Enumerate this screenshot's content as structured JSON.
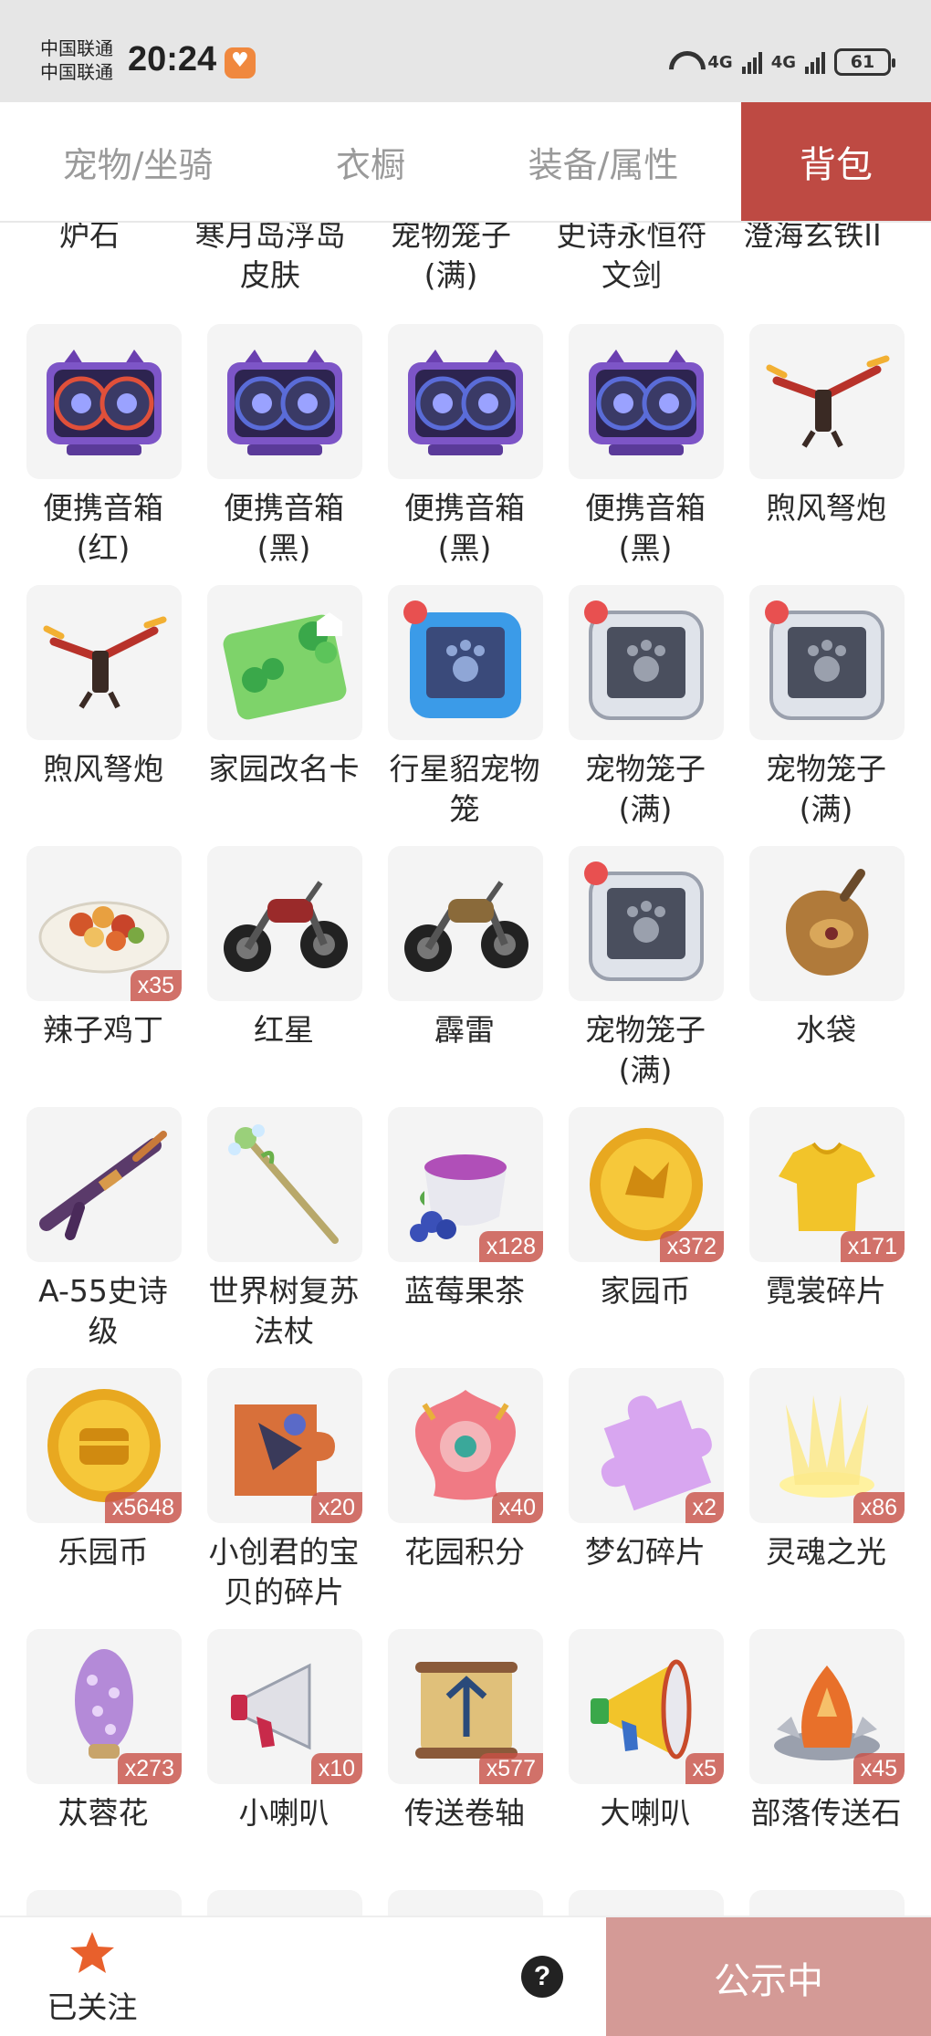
{
  "status_bar": {
    "carrier_1": "中国联通",
    "carrier_2": "中国联通",
    "time": "20:24",
    "network_1": "4G",
    "network_2": "4G",
    "battery": "61"
  },
  "tabs": [
    {
      "label": "宠物/坐骑"
    },
    {
      "label": "衣橱"
    },
    {
      "label": "装备/属性"
    },
    {
      "label": "背包",
      "active": true
    }
  ],
  "colors": {
    "accent": "#be4a43",
    "disabled_button": "#d49a96",
    "badge": "#c85046",
    "star": "#e8602c"
  },
  "top_partial_row": [
    {
      "name": "炉石"
    },
    {
      "name": "寒月岛浮岛\n皮肤"
    },
    {
      "name": "宠物笼子\n(满)"
    },
    {
      "name": "史诗永恒符\n文剑"
    },
    {
      "name": "澄海玄铁II"
    }
  ],
  "items": [
    {
      "name": "便携音箱\n(红)",
      "icon": "speaker-red-icon"
    },
    {
      "name": "便携音箱\n(黑)",
      "icon": "speaker-icon"
    },
    {
      "name": "便携音箱\n(黑)",
      "icon": "speaker-icon"
    },
    {
      "name": "便携音箱\n(黑)",
      "icon": "speaker-icon"
    },
    {
      "name": "煦风弩炮",
      "icon": "crossbow-icon"
    },
    {
      "name": "煦风弩炮",
      "icon": "crossbow-icon"
    },
    {
      "name": "家园改名卡",
      "icon": "rename-card-icon"
    },
    {
      "name": "行星貂宠物\n笼",
      "icon": "pet-cage-blue-icon"
    },
    {
      "name": "宠物笼子\n(满)",
      "icon": "pet-cage-icon"
    },
    {
      "name": "宠物笼子\n(满)",
      "icon": "pet-cage-icon"
    },
    {
      "name": "辣子鸡丁",
      "icon": "food-plate-icon",
      "qty": "x35"
    },
    {
      "name": "红星",
      "icon": "motorcycle-red-icon"
    },
    {
      "name": "霹雷",
      "icon": "motorcycle-icon"
    },
    {
      "name": "宠物笼子\n(满)",
      "icon": "pet-cage-icon"
    },
    {
      "name": "水袋",
      "icon": "water-bag-icon"
    },
    {
      "name": "A-55史诗\n级",
      "icon": "rifle-icon"
    },
    {
      "name": "世界树复苏\n法杖",
      "icon": "staff-icon"
    },
    {
      "name": "蓝莓果茶",
      "icon": "tea-cup-icon",
      "qty": "x128"
    },
    {
      "name": "家园币",
      "icon": "gold-coin-icon",
      "qty": "x372"
    },
    {
      "name": "霓裳碎片",
      "icon": "shirt-icon",
      "qty": "x171"
    },
    {
      "name": "乐园币",
      "icon": "chest-coin-icon",
      "qty": "x5648"
    },
    {
      "name": "小创君的宝\n贝的碎片",
      "icon": "puzzle-picture-icon",
      "qty": "x20"
    },
    {
      "name": "花园积分",
      "icon": "flower-badge-icon",
      "qty": "x40"
    },
    {
      "name": "梦幻碎片",
      "icon": "puzzle-piece-icon",
      "qty": "x2"
    },
    {
      "name": "灵魂之光",
      "icon": "soul-light-icon",
      "qty": "x86"
    },
    {
      "name": "苁蓉花",
      "icon": "purple-flower-icon",
      "qty": "x273"
    },
    {
      "name": "小喇叭",
      "icon": "megaphone-small-icon",
      "qty": "x10"
    },
    {
      "name": "传送卷轴",
      "icon": "scroll-icon",
      "qty": "x577"
    },
    {
      "name": "大喇叭",
      "icon": "megaphone-big-icon",
      "qty": "x5"
    },
    {
      "name": "部落传送石",
      "icon": "teleport-stone-icon",
      "qty": "x45"
    }
  ],
  "bottom_bar": {
    "follow_label": "已关注",
    "help": "?",
    "action_label": "公示中"
  }
}
